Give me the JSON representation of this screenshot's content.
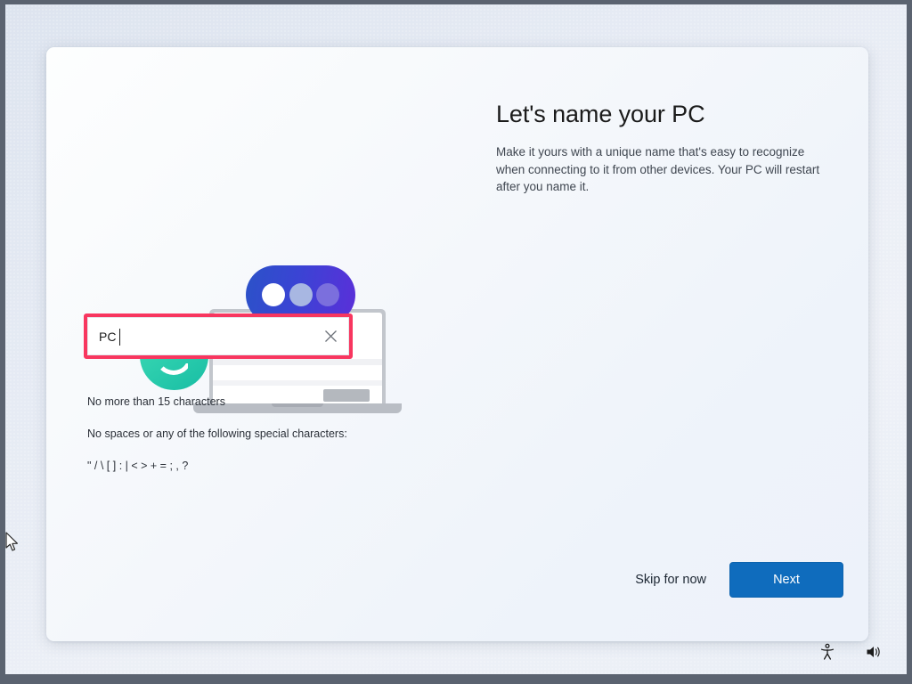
{
  "page": {
    "title": "Let's name your PC",
    "subtitle": "Make it yours with a unique name that's easy to recognize when connecting to it from other devices. Your PC will restart after you name it."
  },
  "name_field": {
    "value": "PC",
    "placeholder": "",
    "clear_icon": "close-icon",
    "annotation_color": "#f8365f"
  },
  "hint": {
    "line1": "No more than 15 characters",
    "line2": "No spaces or any of the following special characters:",
    "line3": "\" / \\ [ ] : | < > + = ; , ?"
  },
  "actions": {
    "skip_label": "Skip for now",
    "next_label": "Next",
    "accent_color": "#0f6cbd"
  },
  "illustration": {
    "name": "name-your-pc-illustration",
    "laptop": "laptop-icon",
    "smiley": "smiley-face-icon",
    "pill": "chat-bubble-dots-icon",
    "teal_color": "#2ecfae",
    "pill_start_color": "#2b52c8",
    "pill_end_color": "#5b2fd9"
  },
  "system_tray": {
    "accessibility_icon": "accessibility-icon",
    "volume_icon": "volume-icon"
  }
}
